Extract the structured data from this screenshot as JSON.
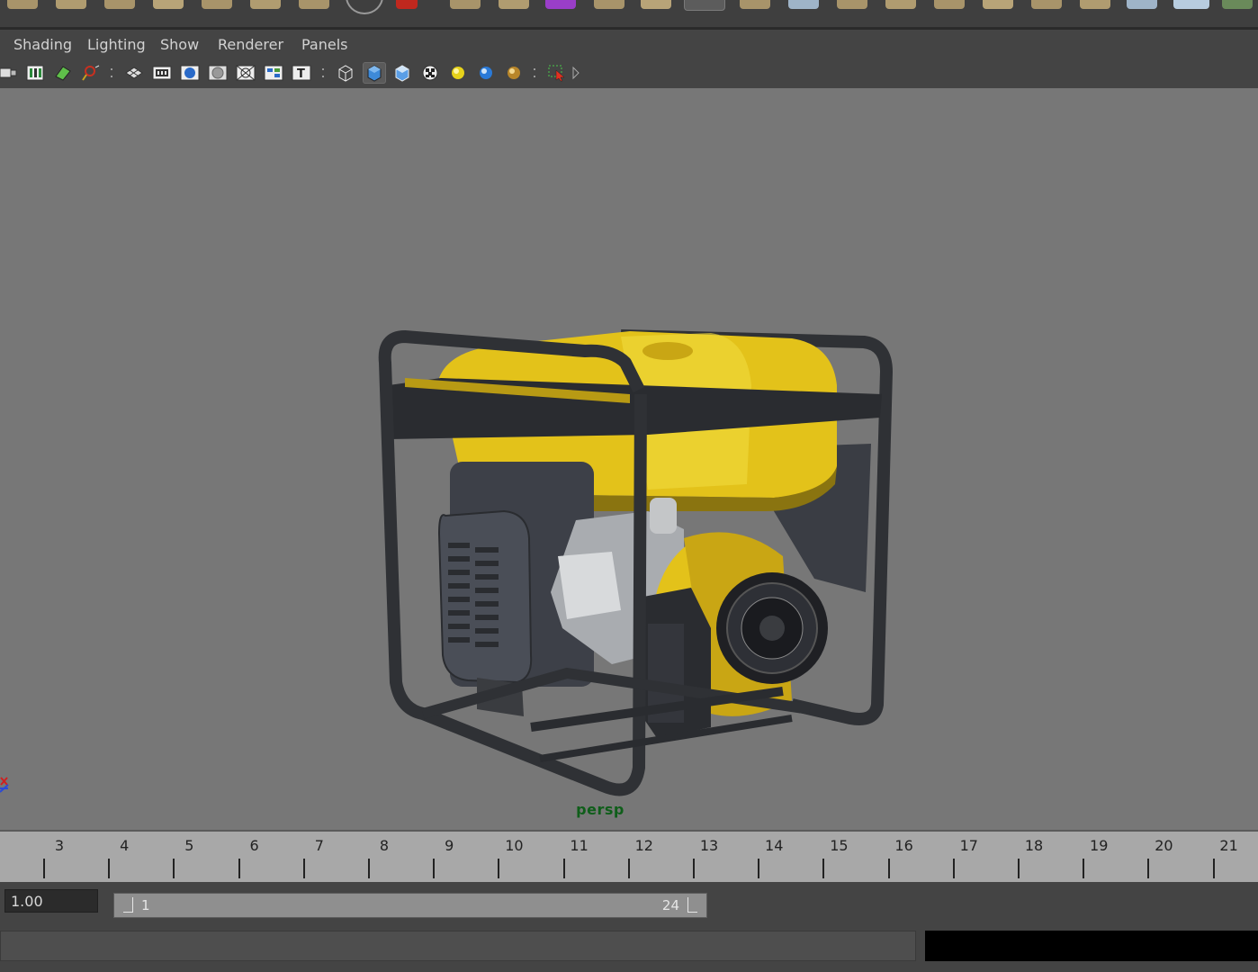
{
  "menubar": {
    "items": [
      "Shading",
      "Lighting",
      "Show",
      "Renderer",
      "Panels"
    ]
  },
  "viewport": {
    "camera": "persp",
    "background": "#777777"
  },
  "timeline": {
    "frames": [
      "3",
      "4",
      "5",
      "6",
      "7",
      "8",
      "9",
      "10",
      "11",
      "12",
      "13",
      "14",
      "15",
      "16",
      "17",
      "18",
      "19",
      "20",
      "21"
    ]
  },
  "range": {
    "current_time": "1.00",
    "start": "1",
    "end": "24"
  },
  "colors": {
    "generator_yellow": "#e3c21a",
    "frame": "#2f3135",
    "camera_label": "#0f5e1a"
  },
  "icons": {
    "toolbar": [
      "camera-attributes-icon",
      "bookmarks-icon",
      "image-plane-icon",
      "2d-pan-zoom-icon",
      "grid-icon",
      "film-gate-icon",
      "resolution-gate-icon",
      "gate-mask-icon",
      "field-chart-icon",
      "safe-action-icon",
      "safe-title-icon",
      "wireframe-icon",
      "smooth-shade-icon",
      "default-material-icon",
      "textured-icon",
      "use-default-light-icon",
      "shadows-icon",
      "screen-space-ao-icon",
      "isolate-select-icon"
    ]
  }
}
